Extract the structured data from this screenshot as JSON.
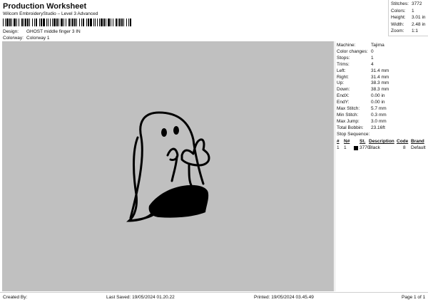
{
  "header": {
    "title": "Production Worksheet",
    "subtitle": "Wilcom EmbroideryStudio – Level 3 Advanced",
    "design_label": "Design:",
    "design_value": "GHOST middle finger 3 IN",
    "colorway_label": "Colorway:",
    "colorway_value": "Colorway 1"
  },
  "stats": [
    {
      "label": "Stitches:",
      "value": "3772"
    },
    {
      "label": "Colors:",
      "value": "1"
    },
    {
      "label": "Height:",
      "value": "3.01 in"
    },
    {
      "label": "Width:",
      "value": "2.48 in"
    },
    {
      "label": "Zoom:",
      "value": "1:1"
    }
  ],
  "properties": [
    {
      "label": "Machine:",
      "value": "Tajima"
    },
    {
      "label": "Color changes:",
      "value": "0"
    },
    {
      "label": "Stops:",
      "value": "1"
    },
    {
      "label": "Trims:",
      "value": "4"
    },
    {
      "label": "Left:",
      "value": "31.4 mm"
    },
    {
      "label": "Right:",
      "value": "31.4 mm"
    },
    {
      "label": "Up:",
      "value": "38.3 mm"
    },
    {
      "label": "Down:",
      "value": "38.3 mm"
    },
    {
      "label": "EndX:",
      "value": "0.00 in"
    },
    {
      "label": "EndY:",
      "value": "0.00 in"
    },
    {
      "label": "Max Stitch:",
      "value": "5.7 mm"
    },
    {
      "label": "Min Stitch:",
      "value": "0.3 mm"
    },
    {
      "label": "Max Jump:",
      "value": "3.0 mm"
    },
    {
      "label": "Total Bobbin:",
      "value": "23.16ft"
    }
  ],
  "stop_sequence": {
    "title": "Stop Sequence:",
    "columns": {
      "hash": "#",
      "n": "N#",
      "st": "St.",
      "description": "Description",
      "code": "Code",
      "brand": "Brand"
    },
    "rows": [
      {
        "hash": "1",
        "n": "1",
        "st": "3770",
        "description": "Black",
        "code": "8",
        "brand": "Default",
        "color": "#000000"
      }
    ]
  },
  "footer": {
    "created_by": "Created By:",
    "last_saved": "Last Saved: 19/05/2024 01.20.22",
    "printed": "Printed: 19/05/2024 03.45.49",
    "page": "Page 1 of 1"
  },
  "colors": {
    "canvas": "#c0c0c0",
    "thread": "#000000"
  }
}
